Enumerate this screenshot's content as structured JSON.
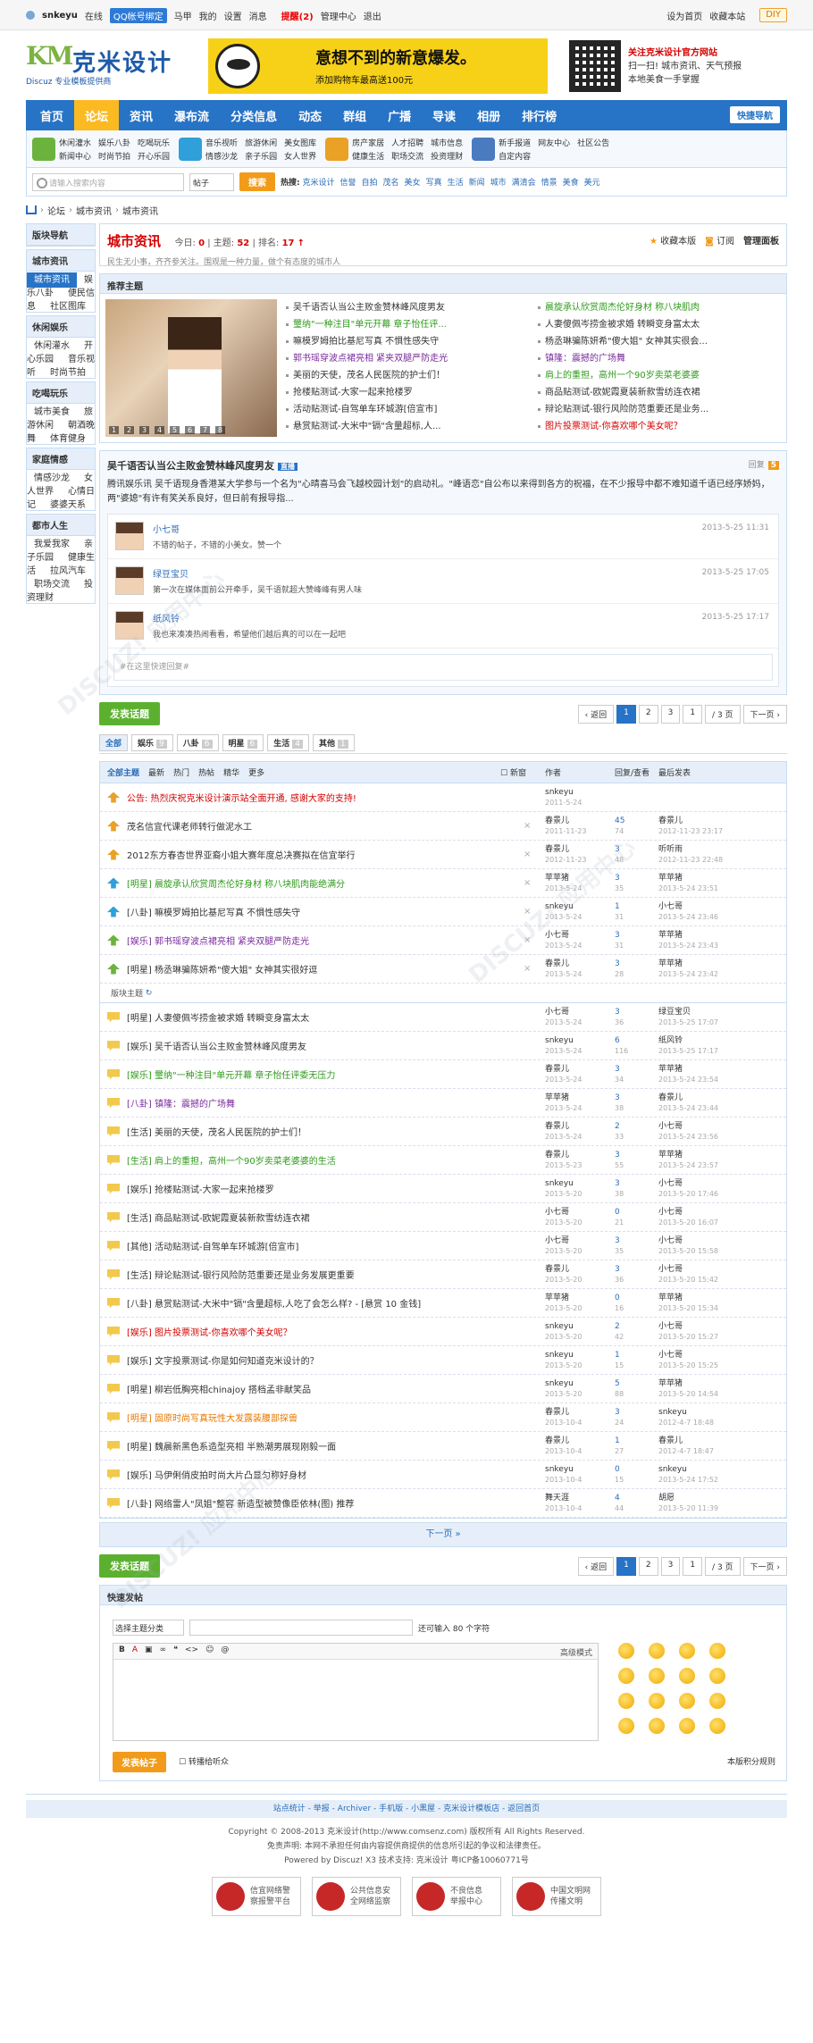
{
  "topbar": {
    "user": "snkeyu",
    "status": "在线",
    "qq_bind": "QQ帐号绑定",
    "links": [
      "马甲",
      "我的",
      "设置",
      "消息"
    ],
    "remind": "提醒(2)",
    "admin": "管理中心",
    "logout": "退出",
    "right": [
      "设为首页",
      "收藏本站"
    ],
    "diy": "DIY"
  },
  "header": {
    "logo_name": "克米设计",
    "logo_sub": "Discuz 专业模板提供商",
    "banner_t1": "意想不到的新意爆发。",
    "banner_t2": "添加购物车最高送100元",
    "qr_lines": [
      "关注克米设计官方网站",
      "扫一扫! 城市资讯、天气预报",
      "本地美食一手掌握"
    ]
  },
  "nav": {
    "items": [
      "首页",
      "论坛",
      "资讯",
      "瀑布流",
      "分类信息",
      "动态",
      "群组",
      "广播",
      "导读",
      "相册",
      "排行榜"
    ],
    "active": 1,
    "quick": "快捷导航"
  },
  "subnav": [
    {
      "links": [
        "休闲灌水",
        "娱乐八卦",
        "吃喝玩乐",
        "新闻中心",
        "时尚节拍",
        "开心乐园"
      ],
      "color": "#6cb33e"
    },
    {
      "links": [
        "音乐视听",
        "旅游休闲",
        "美女图库",
        "情感沙龙",
        "亲子乐园",
        "女人世界"
      ],
      "color": "#2fa0d9"
    },
    {
      "links": [
        "房产家居",
        "人才招聘",
        "城市信息",
        "健康生活",
        "职场交流",
        "投资理财"
      ],
      "color": "#e9a126"
    },
    {
      "links": [
        "新手报道",
        "网友中心",
        "社区公告",
        "自定内容"
      ],
      "color": "#4a7bbf"
    }
  ],
  "search": {
    "placeholder": "请输入搜索内容",
    "type": "帖子",
    "button": "搜索",
    "hot_label": "热搜:",
    "hot": [
      "克米设计",
      "信誉",
      "自拍",
      "茂名",
      "美女",
      "写真",
      "生活",
      "新闻",
      "城市",
      "满清会",
      "情景",
      "美食",
      "美元"
    ]
  },
  "crumb": [
    "论坛",
    "城市资讯",
    "城市资讯"
  ],
  "sidebar": [
    {
      "title": "版块导航",
      "items": []
    },
    {
      "title": "城市资讯",
      "items": [
        "城市资讯",
        "娱乐八卦",
        "便民信息",
        "社区图库"
      ],
      "cur": 0
    },
    {
      "title": "休闲娱乐",
      "items": [
        "休闲灌水",
        "开心乐园",
        "音乐视听",
        "时尚节拍"
      ]
    },
    {
      "title": "吃喝玩乐",
      "items": [
        "城市美食",
        "旅游休闲",
        "朝酒晚舞",
        "体育健身"
      ]
    },
    {
      "title": "家庭情感",
      "items": [
        "情感沙龙",
        "女人世界",
        "心情日记",
        "婆婆天系"
      ]
    },
    {
      "title": "都市人生",
      "items": [
        "我爱我家",
        "亲子乐园",
        "健康生活",
        "拉风汽车",
        "职场交流",
        "投资理财"
      ]
    }
  ],
  "forum": {
    "title": "城市资讯",
    "today_label": "今日:",
    "today": "0",
    "threads_label": "主题:",
    "threads": "52",
    "rank_label": "排名:",
    "rank": "17",
    "desc": "民生无小事，齐齐参关注。围观是一种力量，做个有态度的城市人",
    "actions": [
      "收藏本版",
      "订阅",
      "管理面板"
    ]
  },
  "recommend": {
    "title": "推荐主题",
    "slider": [
      "1",
      "2",
      "3",
      "4",
      "5",
      "6",
      "7",
      "8"
    ],
    "col1": [
      {
        "t": "吴千语否认当公主败金赞林峰风度男友",
        "c": ""
      },
      {
        "t": "璽纳\"一种注目\"单元开幕 章子怡任评...",
        "c": "green"
      },
      {
        "t": "嘛模罗姆拍比基尼写真 不惧性感失守",
        "c": ""
      },
      {
        "t": "郭书瑶穿波点裙亮相 紧夹双腿严防走光",
        "c": "purple"
      },
      {
        "t": "美丽的天使，茂名人民医院的护士们！",
        "c": ""
      },
      {
        "t": "抢楼贴测试-大家一起来抢楼罗",
        "c": ""
      },
      {
        "t": "活动贴测试-自驾单车环城游[倍宣市]",
        "c": ""
      },
      {
        "t": "悬赏贴测试-大米中\"镉\"含量超标,人...",
        "c": ""
      }
    ],
    "col2": [
      {
        "t": "晨旋承认欣赏周杰伦好身材 称八块肌肉",
        "c": "green"
      },
      {
        "t": "人妻傻佩岑捞金被求婚 转瞬变身富太太",
        "c": ""
      },
      {
        "t": "杨丞琳骗陈妍希\"傻大姐\" 女神其实很会...",
        "c": ""
      },
      {
        "t": "镇隆：震撼的广场舞",
        "c": "purple"
      },
      {
        "t": "肩上的重担，高州一个90岁卖菜老婆婆",
        "c": "green"
      },
      {
        "t": "商品贴测试-欧妮霞夏装新款雪纺连衣裙",
        "c": ""
      },
      {
        "t": "辩论贴测试-银行风险防范重要还是业务...",
        "c": ""
      },
      {
        "t": "图片投票测试-你喜欢哪个美女呢？",
        "c": "red"
      }
    ]
  },
  "hotpost": {
    "title": "吴千语否认当公主败金赞林峰风度男友",
    "tag": "直播",
    "reply_label": "回复",
    "reply_count": "5",
    "body": "腾讯娱乐讯 吴千语现身香港某大学参与一个名为\"心晴喜马会飞越校园计划\"的启动礼。\"峰语恋\"自公布以来得到各方的祝福，在不少报导中都不难知道千语已经序娇妈，两\"婆媳\"有许有笑关系良好，但日前有报导指...",
    "replies": [
      {
        "name": "小七哥",
        "text": "不错的帖子，不错的小美女。赞一个",
        "time": "2013-5-25 11:31"
      },
      {
        "name": "绿豆宝贝",
        "text": "第一次在媒体面前公开牵手，吴千语就超大赞峰峰有男人味",
        "time": "2013-5-25 17:05"
      },
      {
        "name": "纸风铃",
        "text": "我也来凑凑热闹看看，希望他们越后真的可以在一起吧",
        "time": "2013-5-25 17:17"
      }
    ],
    "quick_reply": "#在这里快速回复#"
  },
  "pager": {
    "post": "发表话题",
    "prev": "返回",
    "pages": [
      "1",
      "2",
      "3"
    ],
    "jump": "1",
    "total": "/ 3 页",
    "next": "下一页"
  },
  "typebar": [
    {
      "label": "全部",
      "n": ""
    },
    {
      "label": "娱乐",
      "n": "9"
    },
    {
      "label": "八卦",
      "n": "6"
    },
    {
      "label": "明星",
      "n": "6"
    },
    {
      "label": "生活",
      "n": "4"
    },
    {
      "label": "其他",
      "n": "1"
    }
  ],
  "threadlist": {
    "filters": [
      "全部主题",
      "最新",
      "热门",
      "热帖",
      "精华",
      "更多"
    ],
    "new_window": "新窗",
    "author": "作者",
    "reply_view": "回复/查看",
    "last": "最后发表",
    "sep": "版块主题",
    "sticky": [
      {
        "t": "公告: 热烈庆祝克米设计演示站全面开通, 感谢大家的支持!",
        "c": "red",
        "icon": "#e9a126",
        "au": "snkeyu",
        "ad": "2011-5-24",
        "r": "",
        "v": "",
        "lp": "",
        "ld": ""
      },
      {
        "t": "茂名信宜代课老师转行做泥水工",
        "c": "",
        "icon": "#e9a126",
        "au": "春景儿",
        "ad": "2011-11-23",
        "r": "45",
        "v": "74",
        "lp": "春景儿",
        "ld": "2012-11-23 23:17"
      },
      {
        "t": "2012东方春杏世界亚裔小姐大赛年度总决赛拟在信宜举行",
        "c": "",
        "icon": "#e9a126",
        "au": "春景儿",
        "ad": "2012-11-23",
        "r": "3",
        "v": "48",
        "lp": "听听雨",
        "ld": "2012-11-23 22:48"
      },
      {
        "t": "[明星] 晨旋承认欣赏周杰伦好身材 称八块肌肉能绝满分",
        "c": "green",
        "icon": "#2fa0d9",
        "au": "苹苹猪",
        "ad": "2013-5-24",
        "r": "3",
        "v": "35",
        "lp": "苹苹猪",
        "ld": "2013-5-24 23:51"
      },
      {
        "t": "[八卦] 嘛模罗姆拍比基尼写真 不惧性感失守",
        "c": "",
        "icon": "#2fa0d9",
        "au": "snkeyu",
        "ad": "2013-5-24",
        "r": "1",
        "v": "31",
        "lp": "小七哥",
        "ld": "2013-5-24 23:46"
      },
      {
        "t": "[娱乐] 郭书瑶穿波点裙亮相 紧夹双腿严防走光",
        "c": "purple",
        "icon": "#6cb33e",
        "au": "小七哥",
        "ad": "2013-5-24",
        "r": "3",
        "v": "31",
        "lp": "苹苹猪",
        "ld": "2013-5-24 23:43"
      },
      {
        "t": "[明星] 杨丞琳骗陈妍希\"傻大姐\" 女神其实很好逗",
        "c": "",
        "icon": "#6cb33e",
        "au": "春景儿",
        "ad": "2013-5-24",
        "r": "3",
        "v": "28",
        "lp": "苹苹猪",
        "ld": "2013-5-24 23:42"
      }
    ],
    "normal": [
      {
        "t": "[明星] 人妻傻佩岑捞金被求婚 转瞬变身富太太",
        "c": "",
        "au": "小七哥",
        "ad": "2013-5-24",
        "r": "3",
        "v": "36",
        "lp": "绿豆宝贝",
        "ld": "2013-5-25 17:07"
      },
      {
        "t": "[娱乐] 吴千语否认当公主败金赞林峰风度男友",
        "c": "",
        "au": "snkeyu",
        "ad": "2013-5-24",
        "r": "6",
        "v": "116",
        "lp": "纸风铃",
        "ld": "2013-5-25 17:17"
      },
      {
        "t": "[娱乐] 璽纳\"一种注目\"单元开幕 章子怡任评委无压力",
        "c": "green",
        "au": "春景儿",
        "ad": "2013-5-24",
        "r": "3",
        "v": "34",
        "lp": "苹苹猪",
        "ld": "2013-5-24 23:54"
      },
      {
        "t": "[八卦] 镇隆：震撼的广场舞",
        "c": "purple",
        "au": "苹苹猪",
        "ad": "2013-5-24",
        "r": "3",
        "v": "38",
        "lp": "春景儿",
        "ld": "2013-5-24 23:44"
      },
      {
        "t": "[生活] 美丽的天使，茂名人民医院的护士们！",
        "c": "",
        "au": "春景儿",
        "ad": "2013-5-24",
        "r": "2",
        "v": "33",
        "lp": "小七哥",
        "ld": "2013-5-24 23:56"
      },
      {
        "t": "[生活] 肩上的重担，高州一个90岁卖菜老婆婆的生活",
        "c": "green",
        "au": "春景儿",
        "ad": "2013-5-23",
        "r": "3",
        "v": "55",
        "lp": "苹苹猪",
        "ld": "2013-5-24 23:57"
      },
      {
        "t": "[娱乐] 抢楼贴测试-大家一起来抢楼罗",
        "c": "",
        "au": "snkeyu",
        "ad": "2013-5-20",
        "r": "3",
        "v": "38",
        "lp": "小七哥",
        "ld": "2013-5-20 17:46"
      },
      {
        "t": "[生活] 商品贴测试-欧妮霞夏装新款雪纺连衣裙",
        "c": "",
        "au": "小七哥",
        "ad": "2013-5-20",
        "r": "0",
        "v": "21",
        "lp": "小七哥",
        "ld": "2013-5-20 16:07"
      },
      {
        "t": "[其他] 活动贴测试-自驾单车环城游[倍宣市]",
        "c": "",
        "au": "小七哥",
        "ad": "2013-5-20",
        "r": "3",
        "v": "35",
        "lp": "小七哥",
        "ld": "2013-5-20 15:58"
      },
      {
        "t": "[生活] 辩论贴测试-银行风险防范重要还是业务发展更重要",
        "c": "",
        "au": "春景儿",
        "ad": "2013-5-20",
        "r": "3",
        "v": "36",
        "lp": "小七哥",
        "ld": "2013-5-20 15:42"
      },
      {
        "t": "[八卦] 悬赏贴测试-大米中\"镉\"含量超标,人吃了会怎么样? - [悬赏 10 金钱]",
        "c": "",
        "au": "苹苹猪",
        "ad": "2013-5-20",
        "r": "0",
        "v": "16",
        "lp": "苹苹猪",
        "ld": "2013-5-20 15:34"
      },
      {
        "t": "[娱乐] 图片投票测试-你喜欢哪个美女呢？",
        "c": "red",
        "au": "snkeyu",
        "ad": "2013-5-20",
        "r": "2",
        "v": "42",
        "lp": "小七哥",
        "ld": "2013-5-20 15:27"
      },
      {
        "t": "[娱乐] 文字投票测试-你是如何知道克米设计的？",
        "c": "",
        "au": "snkeyu",
        "ad": "2013-5-20",
        "r": "1",
        "v": "15",
        "lp": "小七哥",
        "ld": "2013-5-20 15:25"
      },
      {
        "t": "[明星] 柳岩低胸亮相chinajoy 搭档孟非献笑品",
        "c": "",
        "au": "snkeyu",
        "ad": "2013-5-20",
        "r": "5",
        "v": "88",
        "lp": "苹苹猪",
        "ld": "2013-5-20 14:54"
      },
      {
        "t": "[明星] 固原时尚写真玩性大发露装腰部探兽",
        "c": "orange",
        "au": "春景儿",
        "ad": "2013-10-4",
        "r": "3",
        "v": "24",
        "lp": "snkeyu",
        "ld": "2012-4-7 18:48"
      },
      {
        "t": "[明星] 魏晨新黑色系造型亮相 半熟潮男展现刚毅一面",
        "c": "",
        "au": "春景儿",
        "ad": "2013-10-4",
        "r": "1",
        "v": "27",
        "lp": "春景儿",
        "ld": "2012-4-7 18:47"
      },
      {
        "t": "[娱乐] 马伊俐俏皮拍时尚大片凸显匀称好身材",
        "c": "",
        "au": "snkeyu",
        "ad": "2013-10-4",
        "r": "0",
        "v": "15",
        "lp": "snkeyu",
        "ld": "2013-5-24 17:52"
      },
      {
        "t": "[八卦] 网络雷人\"凤姐\"整容 新造型被赞像臣依林(图) 推荐",
        "c": "",
        "au": "舞天涯",
        "ad": "2013-10-4",
        "r": "4",
        "v": "44",
        "lp": "胡愿",
        "ld": "2013-5-20 11:39"
      }
    ]
  },
  "next_page": "下一页 »",
  "fast": {
    "title": "快速发帖",
    "select": "选择主题分类",
    "remain": "还可输入 80 个字符",
    "adv": "高级模式",
    "submit": "发表帖子",
    "sync": "转播给听众",
    "rule": "本版积分规则"
  },
  "footer": {
    "links": [
      "站点统计",
      "举报",
      "Archiver",
      "手机版",
      "小黑屋",
      "克米设计模板店",
      "返回首页"
    ],
    "copy": "Copyright © 2008-2013 克米设计(http://www.comsenz.com) 版权所有 All Rights Reserved.",
    "disclaim": "免责声明: 本网不承担任何由内容提供商提供的信息所引起的争议和法律责任。",
    "power": "Powered by Discuz! X3  技术支持: 克米设计  粤ICP备10060771号",
    "badges": [
      [
        "信宜网络警",
        "察报警平台"
      ],
      [
        "公共信息安",
        "全网络监察"
      ],
      [
        "不良信息",
        "举报中心"
      ],
      [
        "中国文明网",
        "传播文明"
      ]
    ]
  },
  "colors": {
    "nav": "#2773c6",
    "accent": "#fbba22",
    "title_red": "#d30000",
    "green_btn": "#5bb12f"
  }
}
